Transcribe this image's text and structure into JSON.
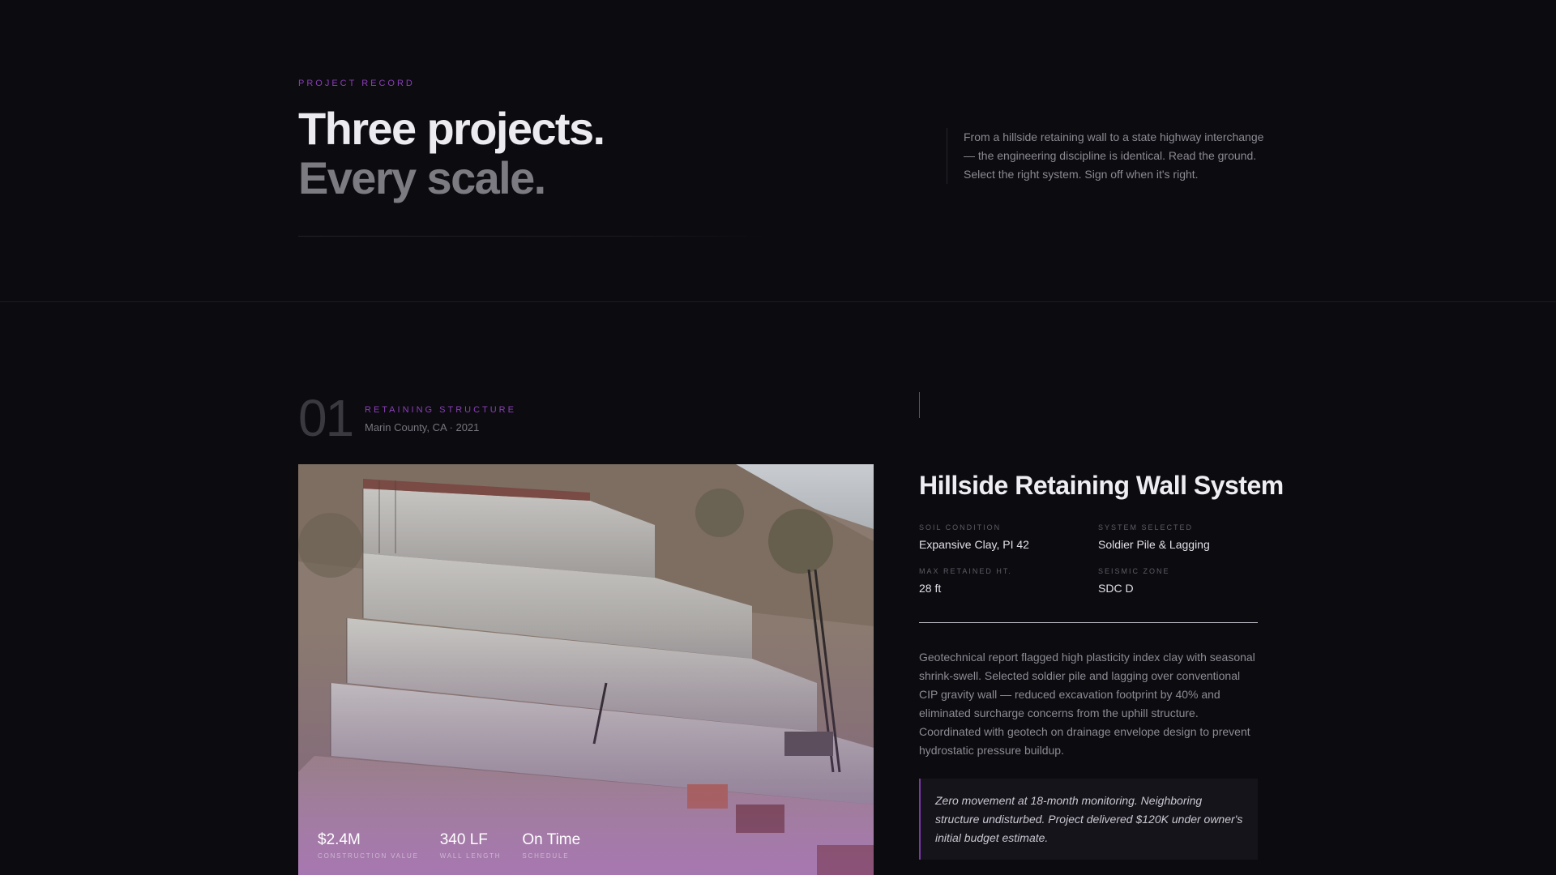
{
  "hero": {
    "eyebrow": "PROJECT RECORD",
    "headline_line1": "Three projects.",
    "headline_line2": "Every scale.",
    "intro": "From a hillside retaining wall to a state highway interchange — the engineering discipline is identical. Read the ground. Select the right system. Sign off when it's right."
  },
  "project": {
    "number": "01",
    "category": "RETAINING STRUCTURE",
    "location": "Marin County, CA · 2021",
    "title": "Hillside Retaining Wall System",
    "photo_alt": "Tiered concrete retaining wall under construction on a hillside with cranes and excavators",
    "stats": [
      {
        "value": "$2.4M",
        "label": "CONSTRUCTION VALUE"
      },
      {
        "value": "340 LF",
        "label": "WALL LENGTH"
      },
      {
        "value": "On Time",
        "label": "SCHEDULE"
      }
    ],
    "specs": [
      {
        "label": "SOIL CONDITION",
        "value": "Expansive Clay, PI 42"
      },
      {
        "label": "SYSTEM SELECTED",
        "value": "Soldier Pile & Lagging"
      },
      {
        "label": "MAX RETAINED HT.",
        "value": "28 ft"
      },
      {
        "label": "SEISMIC ZONE",
        "value": "SDC D"
      }
    ],
    "description": "Geotechnical report flagged high plasticity index clay with seasonal shrink-swell. Selected soldier pile and lagging over conventional CIP gravity wall — reduced excavation footprint by 40% and eliminated surcharge concerns from the uphill structure. Coordinated with geotech on drainage envelope design to prevent hydrostatic pressure buildup.",
    "quote": "Zero movement at 18-month monitoring. Neighboring structure undisturbed. Project delivered $120K under owner's initial budget estimate."
  },
  "colors": {
    "background": "#0c0b10",
    "accent": "#8a3fb8",
    "heading": "#ececf0",
    "muted": "#7d7b82"
  }
}
